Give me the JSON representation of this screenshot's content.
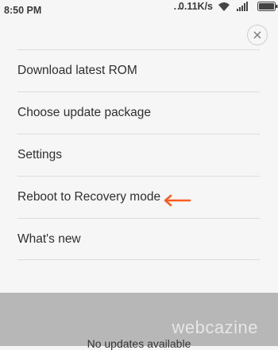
{
  "status_bar": {
    "time": "8:50 PM",
    "dots": "...",
    "speed": "0.11K/s"
  },
  "menu": {
    "items": [
      {
        "label": "Download latest ROM"
      },
      {
        "label": "Choose update package"
      },
      {
        "label": "Settings"
      },
      {
        "label": "Reboot to Recovery mode"
      },
      {
        "label": "What's new"
      }
    ]
  },
  "bottom": {
    "status_text": "No updates available",
    "watermark": "webcazine"
  },
  "colors": {
    "arrow": "#ff5a1f",
    "overlay": "#b7b7b7",
    "background": "#f6f6f6"
  }
}
